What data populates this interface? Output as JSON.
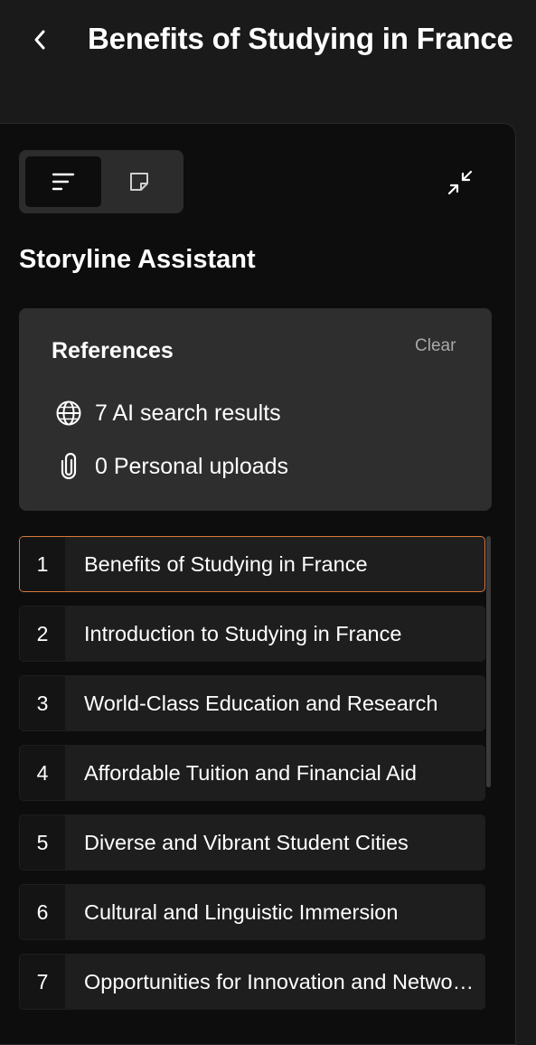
{
  "header": {
    "title": "Benefits of Studying in France"
  },
  "panel": {
    "assistant_title": "Storyline Assistant",
    "references": {
      "title": "References",
      "clear_label": "Clear",
      "search_results": "7 AI search results",
      "uploads": "0 Personal uploads"
    },
    "outline": [
      {
        "num": "1",
        "label": "Benefits of Studying in France",
        "selected": true
      },
      {
        "num": "2",
        "label": "Introduction to Studying in France"
      },
      {
        "num": "3",
        "label": "World-Class Education and Research"
      },
      {
        "num": "4",
        "label": "Affordable Tuition and Financial Aid"
      },
      {
        "num": "5",
        "label": "Diverse and Vibrant Student Cities"
      },
      {
        "num": "6",
        "label": "Cultural and Linguistic Immersion"
      },
      {
        "num": "7",
        "label": "Opportunities for Innovation and Networking"
      }
    ]
  },
  "colors": {
    "selected_border": "#d9773a",
    "panel_bg": "#0d0d0d",
    "page_bg": "#1a1a1a"
  }
}
